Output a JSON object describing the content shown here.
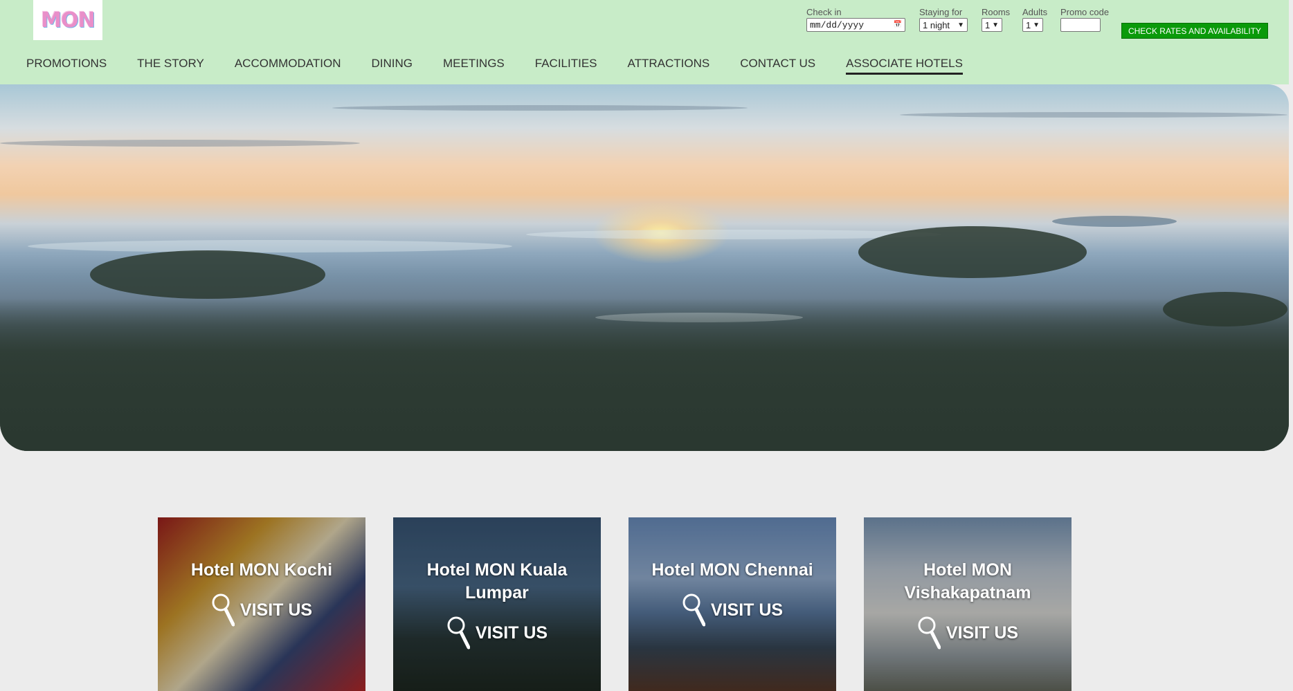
{
  "brand": {
    "logo_text": "MON"
  },
  "booking": {
    "checkin_label": "Check in",
    "checkin_placeholder": "mm/dd/yyyy",
    "staying_label": "Staying for",
    "staying_value": "1 night",
    "rooms_label": "Rooms",
    "rooms_value": "1",
    "adults_label": "Adults",
    "adults_value": "1",
    "promo_label": "Promo code",
    "promo_value": "",
    "button_label": "CHECK RATES AND AVAILABILITY",
    "button_color": "#0a9a0a"
  },
  "nav": {
    "items": [
      "PROMOTIONS",
      "THE STORY",
      "ACCOMMODATION",
      "DINING",
      "MEETINGS",
      "FACILITIES",
      "ATTRACTIONS",
      "CONTACT US",
      "ASSOCIATE HOTELS"
    ],
    "active": "ASSOCIATE HOTELS"
  },
  "colors": {
    "header_bg": "#c8ecc8",
    "page_bg": "#ececec"
  },
  "hotels": [
    {
      "name": "Hotel MON Kochi",
      "cta": "VISIT US",
      "icon": "magnifier-icon"
    },
    {
      "name": "Hotel MON Kuala Lumpar",
      "cta": "VISIT US",
      "icon": "magnifier-icon"
    },
    {
      "name": "Hotel MON Chennai",
      "cta": "VISIT US",
      "icon": "magnifier-icon"
    },
    {
      "name": "Hotel MON Vishakapatnam",
      "cta": "VISIT US",
      "icon": "magnifier-icon"
    }
  ]
}
